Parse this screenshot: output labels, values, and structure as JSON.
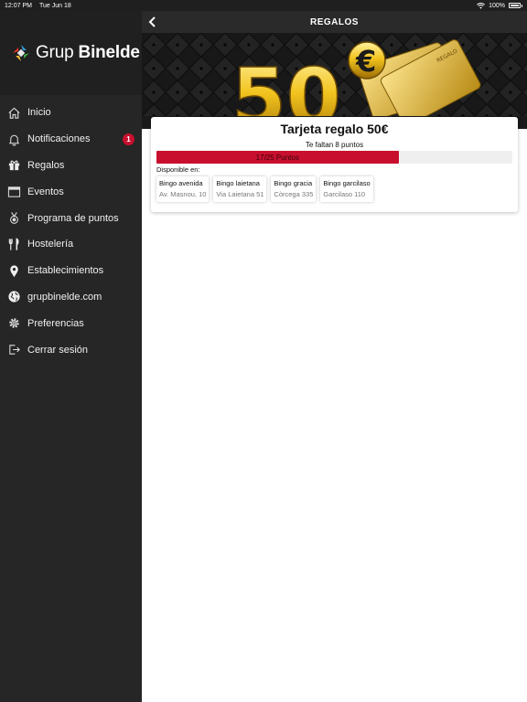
{
  "status_bar": {
    "time": "12:07 PM",
    "date": "Tue Jun 18",
    "battery": "100%"
  },
  "sidebar": {
    "brand": {
      "light": "Grup",
      "bold": "Binelde"
    },
    "items": [
      {
        "label": "Inicio",
        "icon": "home-icon"
      },
      {
        "label": "Notificaciones",
        "icon": "bell-icon",
        "badge": "1"
      },
      {
        "label": "Regalos",
        "icon": "gift-icon"
      },
      {
        "label": "Eventos",
        "icon": "calendar-icon"
      },
      {
        "label": "Programa de puntos",
        "icon": "medal-icon"
      },
      {
        "label": "Hostelería",
        "icon": "cutlery-icon"
      },
      {
        "label": "Establecimientos",
        "icon": "location-pin-icon"
      },
      {
        "label": "grupbinelde.com",
        "icon": "globe-icon"
      },
      {
        "label": "Preferencias",
        "icon": "gear-icon"
      },
      {
        "label": "Cerrar sesión",
        "icon": "logout-icon"
      }
    ]
  },
  "header": {
    "title": "REGALOS",
    "back_icon": "chevron-left-icon"
  },
  "banner": {
    "amount": "50",
    "currency": "€",
    "card_label": "REGALO"
  },
  "gift": {
    "title": "Tarjeta regalo 50€",
    "remaining_text": "Te faltan 8 puntos",
    "progress_text": "17/25 Puntos",
    "progress_fraction": 0.68,
    "available_label": "Disponible en:",
    "locations": [
      {
        "name": "Bingo avenida",
        "address": "Av. Masnou, 10"
      },
      {
        "name": "Bingo laietana",
        "address": "Via Laietana 51"
      },
      {
        "name": "Bingo gracia",
        "address": "Còrcega 335"
      },
      {
        "name": "Bingo garcilaso",
        "address": "Garcilaso 110"
      }
    ]
  },
  "colors": {
    "accent": "#c8102e",
    "sidebar_bg": "#262626",
    "gold": "#e8b820"
  }
}
